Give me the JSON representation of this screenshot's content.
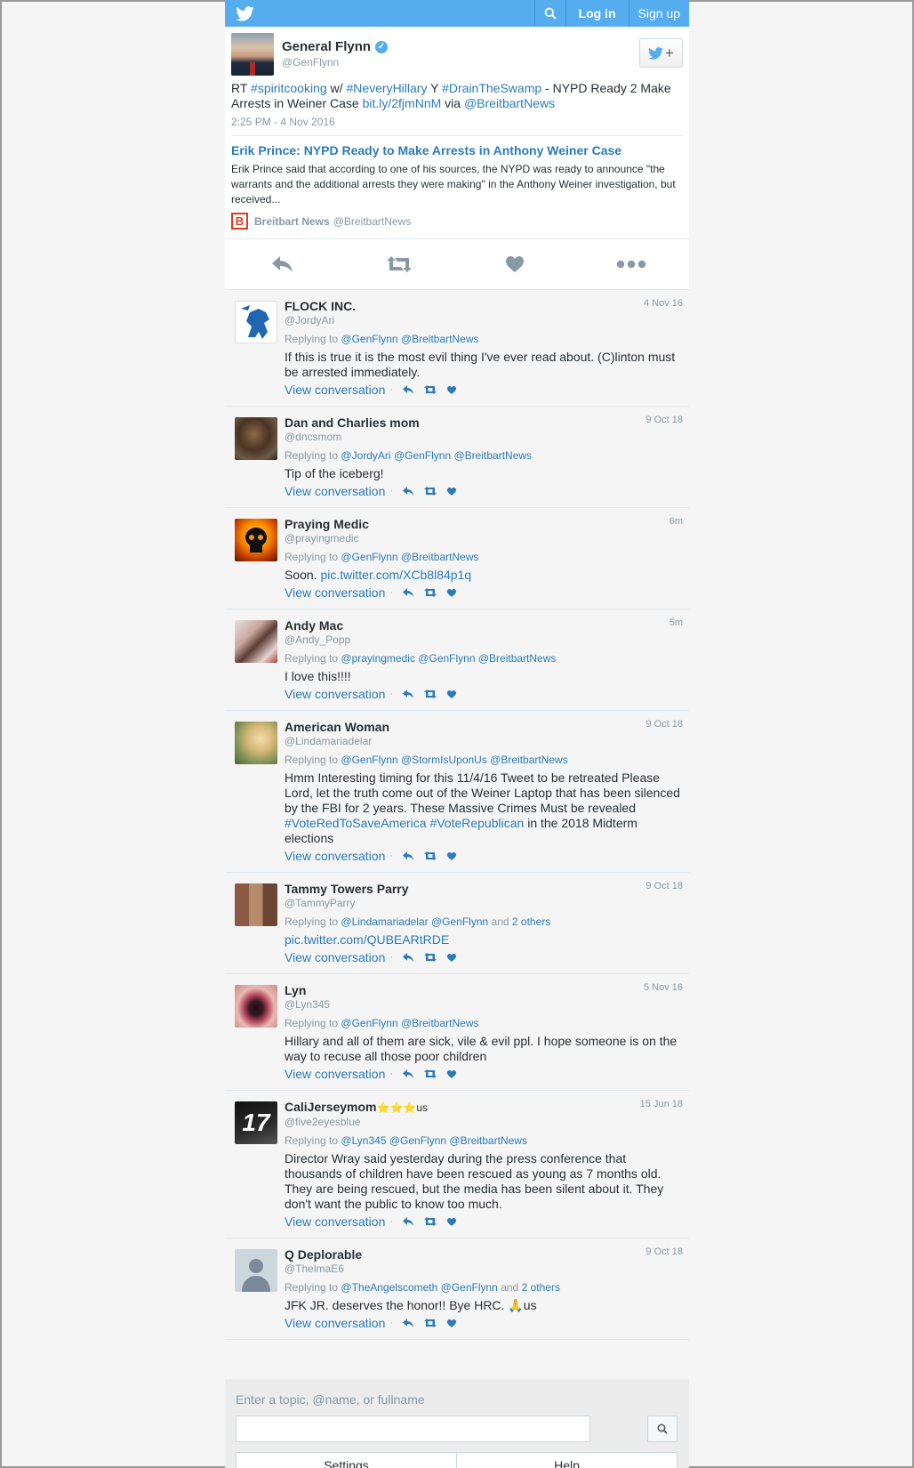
{
  "topbar": {
    "login": "Log in",
    "signup": "Sign up"
  },
  "tweet": {
    "name": "General Flynn",
    "handle": "@GenFlynn",
    "text_parts": [
      {
        "t": "RT ",
        "link": false
      },
      {
        "t": "#spiritcooking",
        "link": true
      },
      {
        "t": " w/ ",
        "link": false
      },
      {
        "t": "#NeveryHillary",
        "link": true
      },
      {
        "t": " Y ",
        "link": false
      },
      {
        "t": "#DrainTheSwamp",
        "link": true
      },
      {
        "t": " - NYPD Ready 2 Make Arrests in Weiner Case ",
        "link": false
      },
      {
        "t": "bit.ly/2fjmNnM",
        "link": true
      },
      {
        "t": " via ",
        "link": false
      },
      {
        "t": "@BreitbartNews",
        "link": true
      }
    ],
    "time": "2:25 PM - 4 Nov 2016",
    "card": {
      "title": "Erik Prince: NYPD Ready to Make Arrests in Anthony Weiner Case",
      "description": "Erik Prince said that according to one of his sources, the NYPD was ready to announce \"the warrants and the additional arrests they were making\" in the Anthony Weiner investigation, but received...",
      "source_name": "Breitbart News",
      "source_handle": "@BreitbartNews",
      "logo_letter": "B"
    }
  },
  "replies": [
    {
      "name": "FLOCK INC.",
      "handle": "@JordyAri",
      "date": "4 Nov 16",
      "replying_label": "Replying to",
      "replying_to": [
        "@GenFlynn",
        "@BreitbartNews"
      ],
      "replying_tail": "",
      "text_parts": [
        {
          "t": "If this is true it is the most evil thing I've ever read about. (C)linton must be arrested immediately.",
          "link": false
        }
      ],
      "view": "View conversation",
      "avatar": "lion"
    },
    {
      "name": "Dan and Charlies mom",
      "handle": "@dncsmom",
      "date": "9 Oct 18",
      "replying_label": "Replying to",
      "replying_to": [
        "@JordyAri",
        "@GenFlynn",
        "@BreitbartNews"
      ],
      "replying_tail": "",
      "text_parts": [
        {
          "t": "Tip of the iceberg!",
          "link": false
        }
      ],
      "view": "View conversation",
      "avatar": "dogs"
    },
    {
      "name": "Praying Medic",
      "handle": "@prayingmedic",
      "date": "6m",
      "replying_label": "Replying to",
      "replying_to": [
        "@GenFlynn",
        "@BreitbartNews"
      ],
      "replying_tail": "",
      "text_parts": [
        {
          "t": "Soon. ",
          "link": false
        },
        {
          "t": "pic.twitter.com/XCb8l84p1q",
          "link": true
        }
      ],
      "view": "View conversation",
      "avatar": "skull"
    },
    {
      "name": "Andy Mac",
      "handle": "@Andy_Popp",
      "date": "5m",
      "replying_label": "Replying to",
      "replying_to": [
        "@prayingmedic",
        "@GenFlynn",
        "@BreitbartNews"
      ],
      "replying_tail": "",
      "text_parts": [
        {
          "t": "I love this!!!!",
          "link": false
        }
      ],
      "view": "View conversation",
      "avatar": "person"
    },
    {
      "name": "American Woman",
      "handle": "@Lindamariadelar",
      "date": "9 Oct 18",
      "replying_label": "Replying to",
      "replying_to": [
        "@GenFlynn",
        "@StormIsUponUs",
        "@BreitbartNews"
      ],
      "replying_tail": "",
      "text_parts": [
        {
          "t": "Hmm Interesting timing for this 11/4/16 Tweet to be retreated Please Lord, let the truth come out of the Weiner Laptop that has been silenced by the FBI for 2 years. These Massive Crimes Must be revealed ",
          "link": false
        },
        {
          "t": "#VoteRedToSaveAmerica",
          "link": true
        },
        {
          "t": " ",
          "link": false
        },
        {
          "t": "#VoteRepublican",
          "link": true
        },
        {
          "t": " in the 2018 Midterm elections",
          "link": false
        }
      ],
      "view": "View conversation",
      "avatar": "puppy"
    },
    {
      "name": "Tammy Towers Parry",
      "handle": "@TammyParry",
      "date": "9 Oct 18",
      "replying_label": "Replying to",
      "replying_to": [
        "@Lindamariadelar",
        "@GenFlynn"
      ],
      "replying_tail": "and",
      "replying_others": "2 others",
      "text_parts": [
        {
          "t": "pic.twitter.com/QUBEARtRDE",
          "link": true
        }
      ],
      "view": "View conversation",
      "avatar": "collage"
    },
    {
      "name": "Lyn",
      "handle": "@Lyn345",
      "date": "5 Nov 16",
      "replying_label": "Replying to",
      "replying_to": [
        "@GenFlynn",
        "@BreitbartNews"
      ],
      "replying_tail": "",
      "text_parts": [
        {
          "t": "Hillary and all of them are sick, vile & evil ppl. I hope someone is on the way to recuse all those poor children",
          "link": false
        }
      ],
      "view": "View conversation",
      "avatar": "eye"
    },
    {
      "name": "CaliJerseymom",
      "name_suffix": "⭐⭐⭐us",
      "handle": "@five2eyesblue",
      "date": "15 Jun 18",
      "replying_label": "Replying to",
      "replying_to": [
        "@Lyn345",
        "@GenFlynn",
        "@BreitbartNews"
      ],
      "replying_tail": "",
      "text_parts": [
        {
          "t": "Director Wray said yesterday during the press conference that thousands of children have been rescued as young as 7 months old. They are being rescued, but the media has been silent about it. They don't want the public to know too much.",
          "link": false
        }
      ],
      "view": "View conversation",
      "avatar": "seventeen",
      "avatar_text": "17"
    },
    {
      "name": "Q Deplorable",
      "handle": "@ThelmaE6",
      "date": "9 Oct 18",
      "replying_label": "Replying to",
      "replying_to": [
        "@TheAngelscometh",
        "@GenFlynn"
      ],
      "replying_tail": "and",
      "replying_others": "2 others",
      "text_parts": [
        {
          "t": "JFK JR. deserves the honor!! Bye HRC. 🙏us",
          "link": false
        }
      ],
      "view": "View conversation",
      "avatar": "default"
    }
  ],
  "search": {
    "label": "Enter a topic, @name, or fullname",
    "value": ""
  },
  "bottomnav": {
    "settings": "Settings",
    "help": "Help"
  },
  "colors": {
    "brand": "#55acee",
    "link": "#2b7bb9",
    "muted": "#8899a6"
  }
}
